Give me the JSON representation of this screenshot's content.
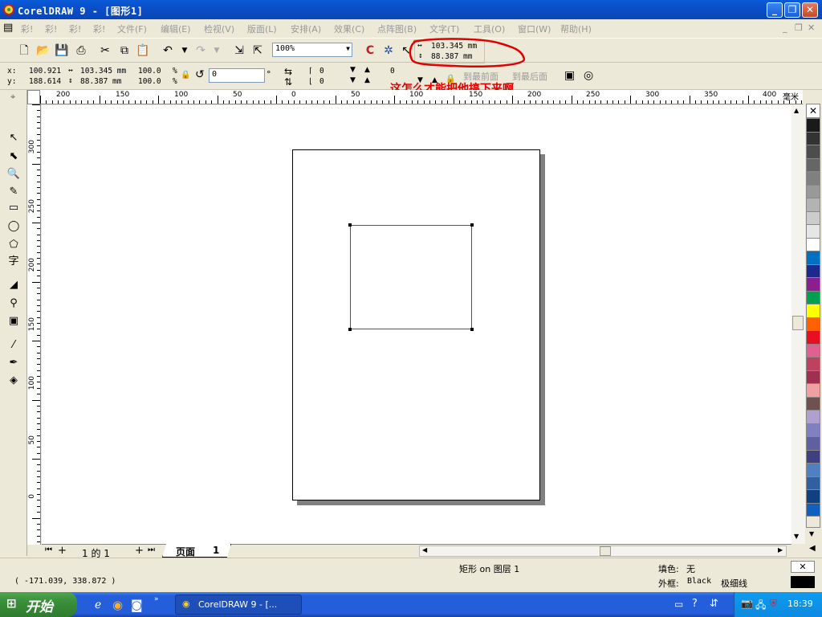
{
  "window": {
    "title": "CorelDRAW 9 - [图形1]",
    "min_icon": "minimize-icon",
    "max_icon": "maximize-icon",
    "close_icon": "close-icon"
  },
  "menu": {
    "items": [
      "文件(F)",
      "编辑(E)",
      "检视(V)",
      "版面(L)",
      "安排(A)",
      "效果(C)",
      "点阵图(B)",
      "文字(T)",
      "工具(O)",
      "窗口(W)",
      "帮助(H)"
    ],
    "left_stubs": [
      "彩!",
      "彩!",
      "彩!",
      "彩!"
    ]
  },
  "toolbar": {
    "zoom": "100%",
    "width_readout": "103.345 mm",
    "height_readout": "88.387 mm"
  },
  "properties": {
    "x_label": "x:",
    "y_label": "y:",
    "x": "100.921",
    "y": "188.614",
    "width": "103.345 mm",
    "height": "88.387 mm",
    "scale_w": "100.0",
    "scale_h": "100.0",
    "pct": "%",
    "rotation": "0",
    "deg": "°",
    "corner1": "0",
    "corner2": "0",
    "corner3": "0",
    "to_front": "到最前面",
    "to_back": "到最后面"
  },
  "annotation": {
    "text": "这怎么才能把他搞下来啊",
    "color": "#e00000"
  },
  "ruler": {
    "unit": "毫米",
    "h_ticks": [
      "200",
      "150",
      "100",
      "50",
      "0",
      "50",
      "100",
      "150",
      "200",
      "250",
      "300",
      "350",
      "400"
    ],
    "v_ticks": [
      "300",
      "250",
      "200",
      "150",
      "100",
      "50",
      "0"
    ]
  },
  "pagebar": {
    "page_count": "1 的 1",
    "tab": "页面",
    "tab_num": "1"
  },
  "status": {
    "coords": "( -171.039, 338.872 )",
    "object": "矩形 on 图层 1",
    "fill_label": "填色:",
    "fill_value": "无",
    "outline_label": "外框:",
    "outline_value": "Black",
    "outline_width": "极细线"
  },
  "taskbar": {
    "start": "开始",
    "task": "CorelDRAW 9 - [...",
    "clock": "18:39"
  },
  "palette": [
    "#1a1a1a",
    "#333333",
    "#4d4d4d",
    "#666666",
    "#808080",
    "#999999",
    "#b3b3b3",
    "#cccccc",
    "#e6e6e6",
    "#ffffff",
    "#0070c0",
    "#1c2a8c",
    "#8a2090",
    "#00a050",
    "#ffff00",
    "#ff6000",
    "#e81020",
    "#e06090",
    "#c04060",
    "#a03050",
    "#f0a0a0",
    "#705050",
    "#b0a0d0",
    "#8080c0",
    "#6060a0",
    "#404080",
    "#5080c0",
    "#3060a0",
    "#104080",
    "#1060c0"
  ]
}
